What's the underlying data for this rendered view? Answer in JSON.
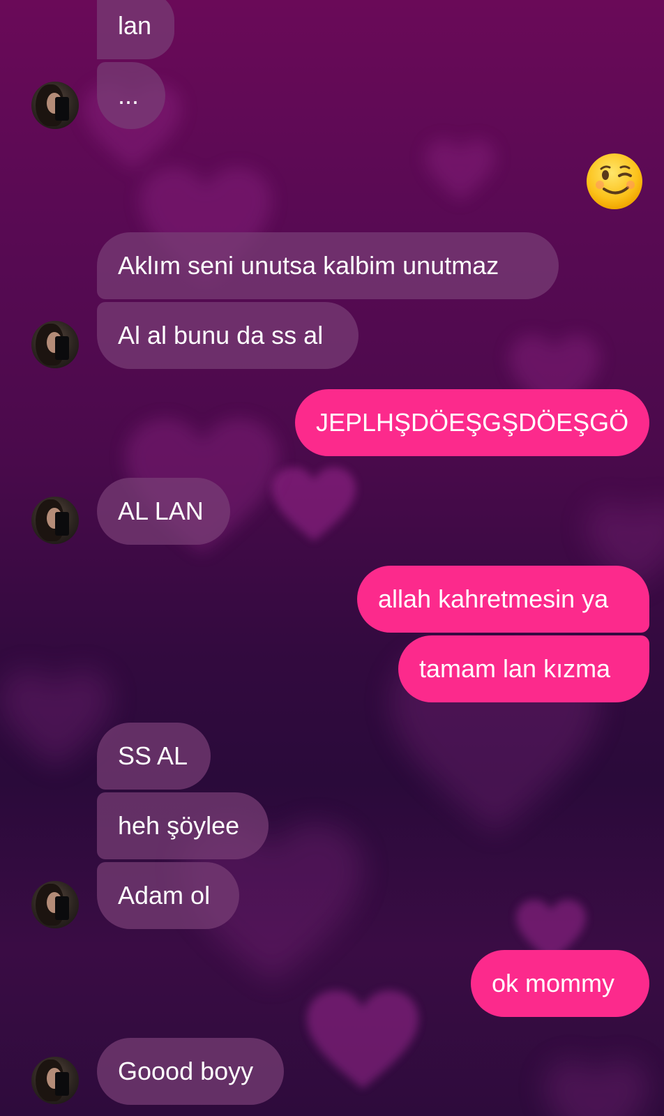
{
  "messages": [
    {
      "text": "lan",
      "direction": "incoming"
    },
    {
      "text": "...",
      "direction": "incoming"
    },
    {
      "icon": "winking-face-emoji",
      "direction": "outgoing"
    },
    {
      "text": "Aklım seni unutsa kalbim unutmaz",
      "direction": "incoming"
    },
    {
      "text": "Al al bunu da ss al",
      "direction": "incoming"
    },
    {
      "text": "JEPLHŞDÖEŞGŞDÖEŞGÖ",
      "direction": "outgoing"
    },
    {
      "text": "AL LAN",
      "direction": "incoming"
    },
    {
      "text": "allah kahretmesin ya",
      "direction": "outgoing"
    },
    {
      "text": "tamam lan kızma",
      "direction": "outgoing"
    },
    {
      "text": "SS AL",
      "direction": "incoming"
    },
    {
      "text": "heh şöylee",
      "direction": "incoming"
    },
    {
      "text": "Adam ol",
      "direction": "incoming"
    },
    {
      "text": "ok mommy",
      "direction": "outgoing"
    },
    {
      "text": "Goood boyy",
      "direction": "incoming"
    }
  ],
  "colors": {
    "outgoing_bubble": "#fc2a8c",
    "incoming_bubble": "#783e76",
    "text": "#ffffff",
    "background_top": "#6a0a58",
    "background_bottom": "#2e0b3c"
  }
}
